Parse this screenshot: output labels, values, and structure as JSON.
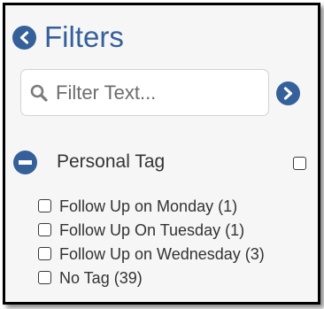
{
  "header": {
    "title": "Filters",
    "back_icon": "chevron-left-circle-icon"
  },
  "search": {
    "placeholder": "Filter Text...",
    "value": "",
    "icon": "search-icon",
    "submit_icon": "chevron-right-circle-icon"
  },
  "group": {
    "label": "Personal Tag",
    "expanded": true,
    "checked": false,
    "toggle_icon": "minus-circle-icon"
  },
  "tags": [
    {
      "label": "Follow Up on Monday (1)",
      "checked": false
    },
    {
      "label": "Follow Up On Tuesday (1)",
      "checked": false
    },
    {
      "label": "Follow Up on Wednesday (3)",
      "checked": false
    },
    {
      "label": "No Tag (39)",
      "checked": false
    }
  ],
  "colors": {
    "accent": "#35609a",
    "panel_background": "#f6f6f6",
    "text": "#333333"
  }
}
